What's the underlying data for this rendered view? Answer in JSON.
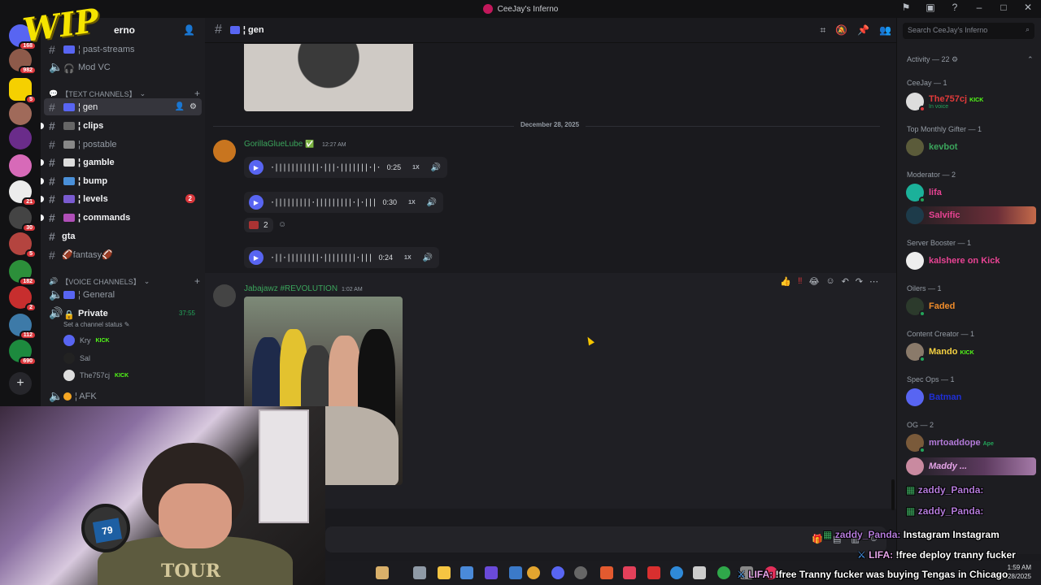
{
  "window": {
    "title": "CeeJay's Inferno"
  },
  "server": {
    "name_partial": "erno",
    "overlay_logo": "WIP",
    "rail_badges": [
      "168",
      "982",
      "5",
      "21",
      "30",
      "5",
      "182",
      "2",
      "112",
      "690"
    ]
  },
  "channels": {
    "top": [
      {
        "label": "¦ past-streams"
      },
      {
        "label": "Mod VC"
      }
    ],
    "text_category": "【TEXT CHANNELS】",
    "text_channels": [
      {
        "label": "¦ gen"
      },
      {
        "label": "¦ clips"
      },
      {
        "label": "¦ postable"
      },
      {
        "label": "¦ gamble"
      },
      {
        "label": "¦ bump"
      },
      {
        "label": "¦ levels",
        "badge": "2"
      },
      {
        "label": "¦ commands"
      },
      {
        "label": "gta"
      },
      {
        "label": "🏈fantasy🏈"
      }
    ],
    "voice_category": "【VOICE CHANNELS】",
    "voice_channels": {
      "general": "¦ General",
      "private": "Private",
      "private_timer": "37:55",
      "status_hint": "Set a channel status",
      "afk": "¦ AFK"
    },
    "voice_users": [
      {
        "name": "Kry",
        "tag": "KICK"
      },
      {
        "name": "Sal",
        "tag": ""
      },
      {
        "name": "The757cj",
        "tag": "KICK"
      }
    ]
  },
  "chat": {
    "channel_name": "¦ gen",
    "date_divider": "December 28, 2025",
    "message1": {
      "author": "GorillaGlueLube",
      "time": "12:27 AM",
      "voice_clips": [
        {
          "duration": "0:25",
          "speed": "1X"
        },
        {
          "duration": "0:30",
          "speed": "1X"
        },
        {
          "duration": "0:24",
          "speed": "1X"
        }
      ],
      "reaction_count": "2"
    },
    "message2": {
      "author": "Jabajawz #REVOLUTION",
      "time": "1:02 AM"
    }
  },
  "members": {
    "search_placeholder": "Search CeeJay's Inferno",
    "activity_header": "Activity — 22",
    "groups": [
      {
        "title": "CeeJay — 1",
        "members": [
          {
            "name": "The757cj",
            "sub": "In voice",
            "tag": "KICK",
            "color": "#e03a3a"
          }
        ]
      },
      {
        "title": "Top Monthly Gifter — 1",
        "members": [
          {
            "name": "kevbot",
            "color": "#3ba55c"
          }
        ]
      },
      {
        "title": "Moderator — 2",
        "members": [
          {
            "name": "lifa",
            "color": "#e84393"
          },
          {
            "name": "Salvific",
            "color": "#e84393"
          }
        ]
      },
      {
        "title": "Server Booster — 1",
        "members": [
          {
            "name": "kalshere on Kick",
            "color": "#e84393"
          }
        ]
      },
      {
        "title": "Oilers — 1",
        "members": [
          {
            "name": "Faded",
            "color": "#f08c2a"
          }
        ]
      },
      {
        "title": "Content Creator — 1",
        "members": [
          {
            "name": "Mando",
            "tag": "KICK",
            "color": "#f5d142"
          }
        ]
      },
      {
        "title": "Spec Ops — 1",
        "members": [
          {
            "name": "Batman",
            "color": "#1f2fd6"
          }
        ]
      },
      {
        "title": "OG — 2",
        "members": [
          {
            "name": "mrtoaddope",
            "tag": "Ape",
            "color": "#b37ad9"
          },
          {
            "name": "Maddy ...",
            "color": "#e5a4e8"
          }
        ]
      }
    ]
  },
  "stream_overlay": {
    "lines": [
      {
        "user": "zaddy_Panda:",
        "text": ""
      },
      {
        "user": "zaddy_Panda:",
        "text": ""
      },
      {
        "user": "zaddy_Panda:",
        "text": "Instagram Instagram"
      },
      {
        "user": "LIFA:",
        "text": "!free deploy tranny fucker"
      },
      {
        "user": "LIFA:",
        "text": "!free Tranny fucker was buying Tengas in Chicago"
      }
    ]
  },
  "taskbar": {
    "time": "1:59 AM",
    "date": "12/28/2025"
  },
  "colors": {
    "accent": "#5865f2",
    "online": "#23a55a",
    "kick": "#53fc18",
    "mention": "#da373c"
  }
}
